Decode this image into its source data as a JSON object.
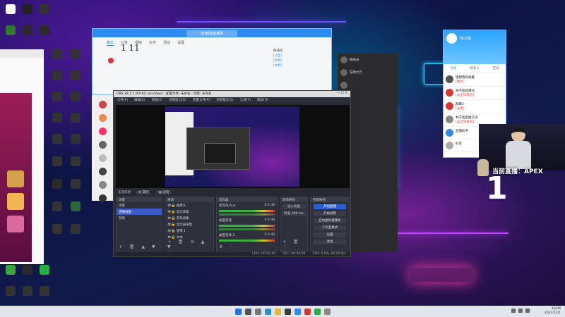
{
  "qq_main": {
    "title": "QQ频道直播间",
    "tabs": [
      "聊天",
      "公告",
      "相册",
      "文件",
      "活动",
      "设置"
    ],
    "handwriting": "1 11",
    "side_items": [
      "群通知",
      "[公告]",
      "[文件]",
      "[文件]"
    ]
  },
  "qq_right": {
    "username": "林子超",
    "tabs": [
      "消息",
      "联系人",
      "空间"
    ],
    "contacts": [
      {
        "name": "理想教程收藏",
        "msg": "[图片]"
      },
      {
        "name": "林子超直播间",
        "msg": "[@全体成员]"
      },
      {
        "name": "群聊2",
        "msg": "[@我]"
      },
      {
        "name": "林子超直播交流",
        "msg": "[@全体成员]"
      },
      {
        "name": "直播助手",
        "msg": ""
      },
      {
        "name": "好友",
        "msg": ""
      }
    ]
  },
  "dark_panel": {
    "rows": [
      "群成员",
      "游戏大厅",
      "",
      "",
      "",
      "",
      "",
      "",
      "",
      ""
    ]
  },
  "obs": {
    "title": "OBS 28.1.2 (64-bit, windows) - 配置文件: 未命名 - 场景: 未命名",
    "menus": [
      "文件(F)",
      "编辑(E)",
      "视图(V)",
      "停靠窗口(D)",
      "配置文件(P)",
      "场景集合(S)",
      "工具(T)",
      "帮助(H)"
    ],
    "source_label": "未选择源",
    "props_btn": "属性",
    "filter_btn": "滤镜",
    "docks": {
      "scenes": {
        "title": "场景",
        "items": [
          "场景",
          "直播画面",
          "游戏"
        ]
      },
      "sources": {
        "title": "来源",
        "items": [
          "摄像头",
          "窗口采集",
          "游戏采集",
          "显示器采集",
          "图像 1",
          "文本"
        ]
      },
      "mixer": {
        "title": "混音器",
        "channels": [
          {
            "name": "麦克风/Aux",
            "db": "0.0 dB"
          },
          {
            "name": "桌面音频",
            "db": "0.0 dB"
          },
          {
            "name": "桌面音频 2",
            "db": "0.0 dB"
          }
        ]
      },
      "transitions": {
        "title": "转场特效",
        "mode": "淡入淡出",
        "duration": "时长 300 ms"
      },
      "controls": {
        "title": "控制按钮",
        "buttons": [
          "开始直播",
          "开始录制",
          "启动虚拟摄像机",
          "工作室模式",
          "设置",
          "退出"
        ]
      }
    },
    "status": {
      "live": "LIVE: 00:00:00",
      "rec": "REC: 00:00:00",
      "cpu": "CPU: 0.6%, 60.00 fps"
    }
  },
  "stream": {
    "live_label": "当前直播：APEX",
    "big_number": "1"
  },
  "taskbar": {
    "time": "18:04",
    "date": "2022/12/1"
  },
  "colors": {
    "qq_blue": "#2d8cf0",
    "obs_bg": "#272a33",
    "obs_primary": "#2d5fd1",
    "neon_purple": "#c040ff",
    "neon_cyan": "#29d8ff"
  }
}
